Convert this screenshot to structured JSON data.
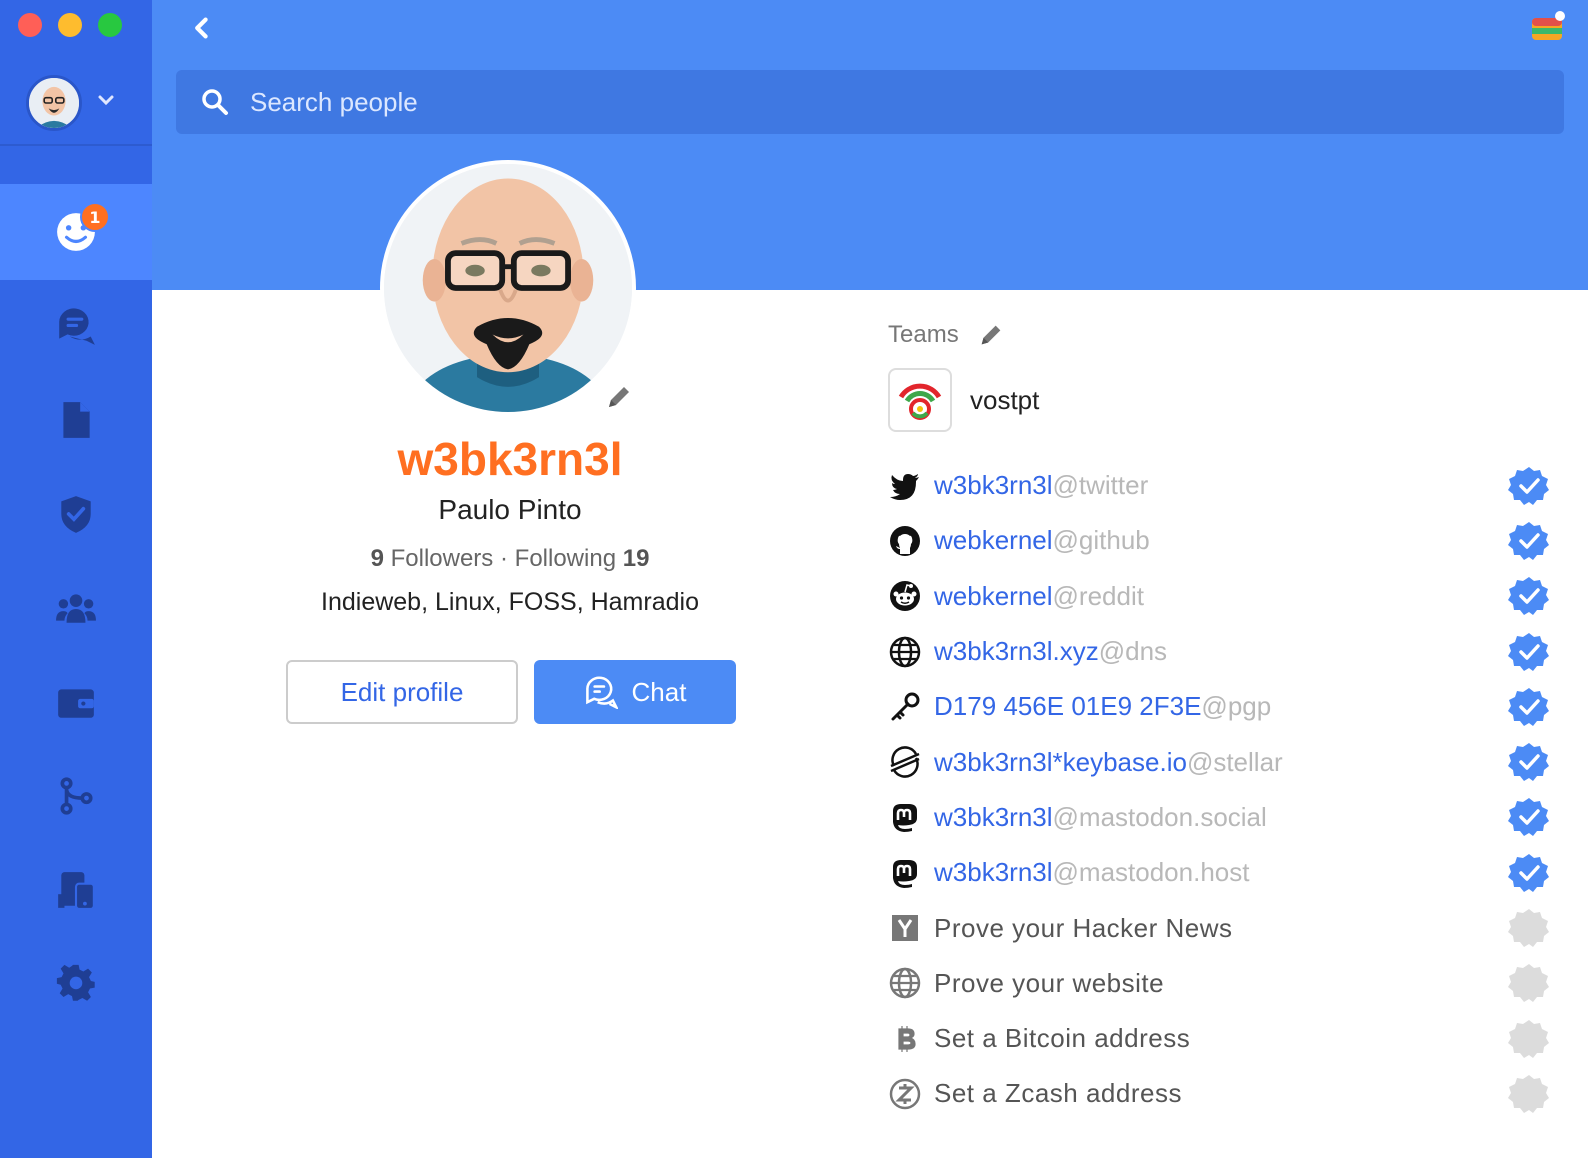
{
  "header": {
    "search_placeholder": "Search people"
  },
  "sidebar": {
    "badge_count": "1",
    "items": [
      {
        "name": "people",
        "icon": "smiley-icon",
        "active": true
      },
      {
        "name": "chat",
        "icon": "chat-bubbles-icon"
      },
      {
        "name": "files",
        "icon": "file-icon"
      },
      {
        "name": "crypto",
        "icon": "shield-check-icon"
      },
      {
        "name": "teams",
        "icon": "team-icon"
      },
      {
        "name": "wallet",
        "icon": "wallet-icon"
      },
      {
        "name": "git",
        "icon": "git-branch-icon"
      },
      {
        "name": "devices",
        "icon": "devices-icon"
      },
      {
        "name": "settings",
        "icon": "gear-icon"
      }
    ]
  },
  "profile": {
    "username": "w3bk3rn3l",
    "full_name": "Paulo Pinto",
    "followers_count": "9",
    "followers_label": "Followers",
    "separator": "·",
    "following_label": "Following",
    "following_count": "19",
    "bio": "Indieweb, Linux, FOSS, Hamradio",
    "edit_button": "Edit profile",
    "chat_button": "Chat"
  },
  "teams": {
    "label": "Teams",
    "items": [
      {
        "name": "vostpt"
      }
    ]
  },
  "proofs": [
    {
      "icon": "twitter-icon",
      "user": "w3bk3rn3l",
      "service": "@twitter",
      "verified": true
    },
    {
      "icon": "github-icon",
      "user": "webkernel",
      "service": "@github",
      "verified": true
    },
    {
      "icon": "reddit-icon",
      "user": "webkernel",
      "service": "@reddit",
      "verified": true
    },
    {
      "icon": "globe-icon",
      "user": "w3bk3rn3l.xyz",
      "service": "@dns",
      "verified": true
    },
    {
      "icon": "key-icon",
      "user": "D179 456E 01E9 2F3E",
      "service": "@pgp",
      "verified": true
    },
    {
      "icon": "stellar-icon",
      "user": "w3bk3rn3l*keybase.io",
      "service": "@stellar",
      "verified": true
    },
    {
      "icon": "mastodon-icon",
      "user": "w3bk3rn3l",
      "service": "@mastodon.social",
      "verified": true
    },
    {
      "icon": "mastodon-icon",
      "user": "w3bk3rn3l",
      "service": "@mastodon.host",
      "verified": true
    }
  ],
  "prompts": [
    {
      "icon": "hackernews-icon",
      "text": "Prove your Hacker News"
    },
    {
      "icon": "globe-icon",
      "text": "Prove your website"
    },
    {
      "icon": "bitcoin-icon",
      "text": "Set a Bitcoin address"
    },
    {
      "icon": "zcash-icon",
      "text": "Set a Zcash address"
    }
  ],
  "colors": {
    "sidebar": "#3366e6",
    "header": "#4c8bf5",
    "accent_orange": "#ff6f21",
    "link_blue": "#3366e6",
    "verified_blue": "#4c8bf5"
  }
}
